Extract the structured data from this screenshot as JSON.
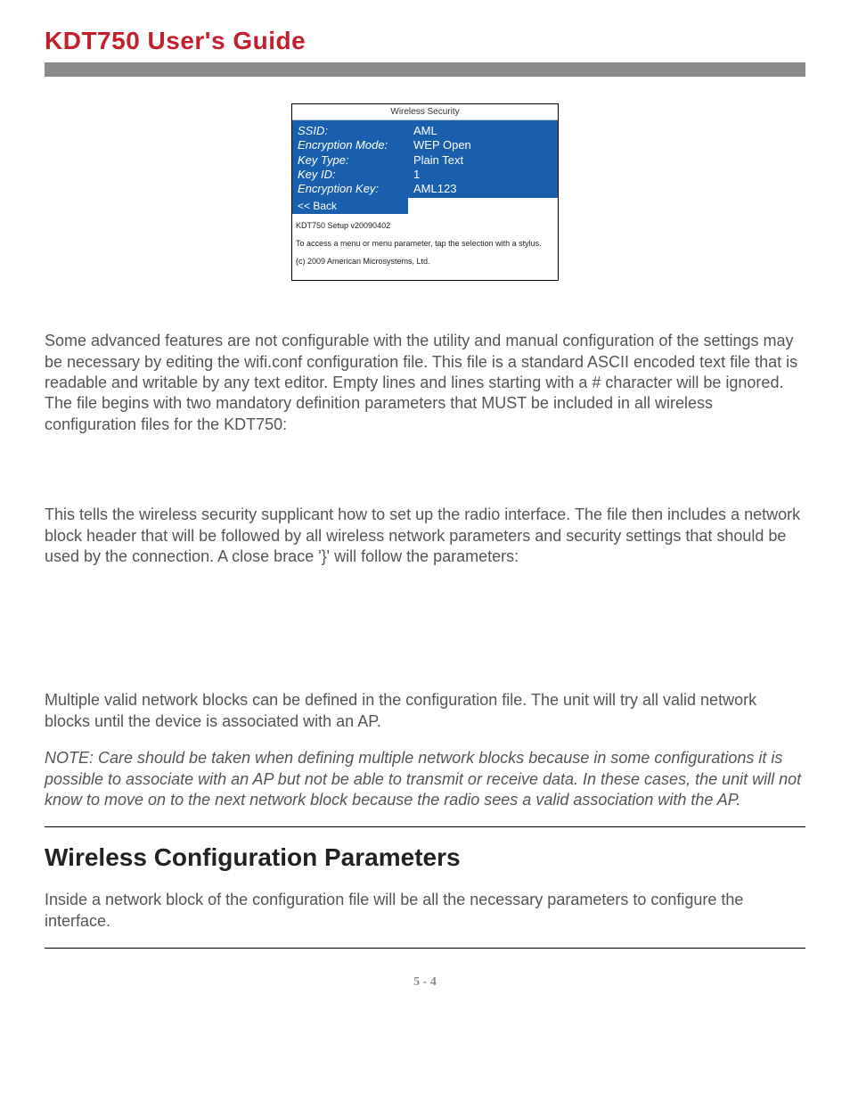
{
  "doc_title": "KDT750 User's Guide",
  "screenshot": {
    "title": "Wireless Security",
    "rows": [
      {
        "label": "SSID:",
        "value": "AML"
      },
      {
        "label": "Encryption Mode:",
        "value": "WEP Open"
      },
      {
        "label": "Key Type:",
        "value": "Plain Text"
      },
      {
        "label": "Key ID:",
        "value": "1"
      },
      {
        "label": "Encryption Key:",
        "value": "AML123"
      }
    ],
    "back": "<< Back",
    "footer1": "KDT750 Setup v20090402",
    "footer2": "To access a menu or menu parameter, tap the selection with a stylus.",
    "footer3": "(c) 2009 American Microsystems, Ltd."
  },
  "para1": "Some advanced features are not configurable with the utility and manual configuration of the settings may be necessary by editing the wifi.conf configuration file.   This file is a standard ASCII encoded text file that is readable and writable by any text editor.  Empty lines and lines starting with a # character will be ignored.  The file begins with two mandatory definition parameters that MUST be included in all wireless configuration files for the KDT750:",
  "para2": "This tells the wireless security supplicant how to set up the radio interface. The file then includes a network block header that will be followed by all wireless network parameters and security settings that should be used by the connection. A close brace '}' will follow the parameters:",
  "para3": "Multiple valid network blocks can be defined in the configuration file. The unit will try all valid network blocks until the device is associated with an AP.",
  "note": "NOTE: Care should be taken when defining multiple network blocks because in some configurations it is possible to associate with an AP but not be able to transmit or receive data. In these cases, the unit will not know to move on to the next network block because the radio sees a valid association with the AP.",
  "section_heading": "Wireless Configuration Parameters",
  "para4": "Inside a network block of the configuration file will be all the necessary parameters to configure the interface.",
  "page_num": "5 - 4"
}
